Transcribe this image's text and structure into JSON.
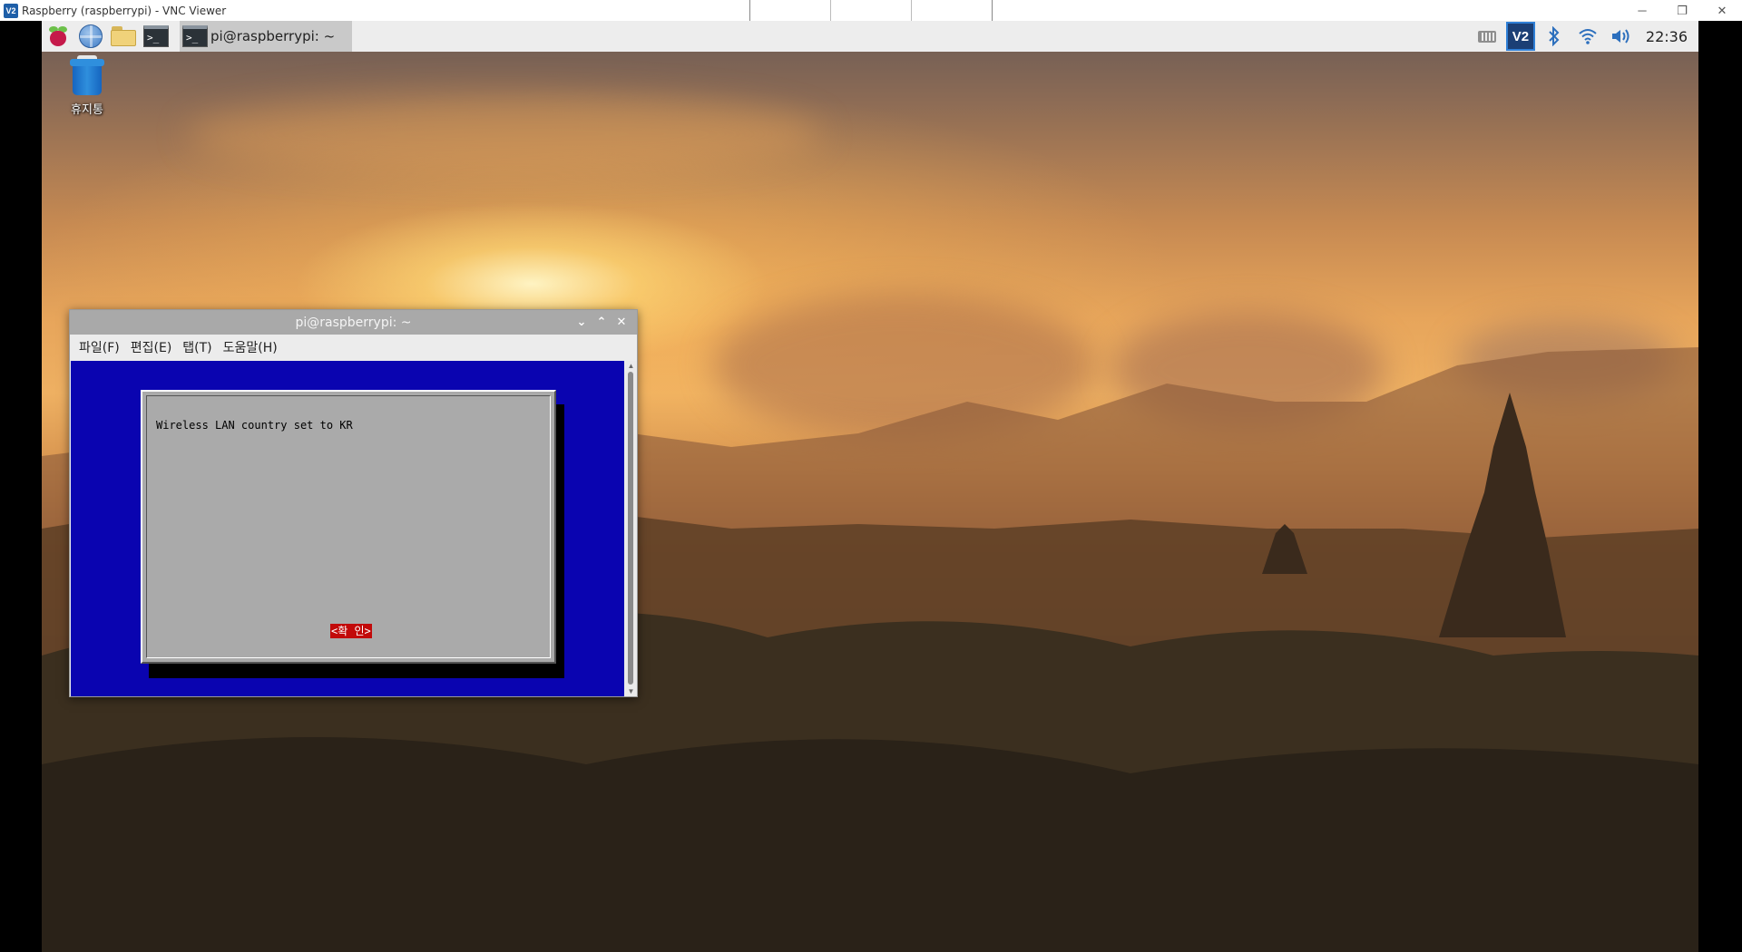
{
  "vnc": {
    "icon_text": "V2",
    "title": "Raspberry (raspberrypi) - VNC Viewer",
    "controls": [
      "─",
      "❐",
      "✕"
    ]
  },
  "panel": {
    "task_title": "pi@raspberrypi: ~",
    "tray": {
      "vnc_text": "V2",
      "bluetooth": "bluetooth-icon",
      "wifi": "wifi-icon",
      "volume": "volume-icon",
      "clock": "22:36"
    }
  },
  "desktop": {
    "trash_label": "휴지통"
  },
  "terminal": {
    "title": "pi@raspberrypi: ~",
    "controls": [
      "⌄",
      "⌃",
      "✕"
    ],
    "menu": [
      "파일(F)",
      "편집(E)",
      "탭(T)",
      "도움말(H)"
    ],
    "dialog": {
      "message": "Wireless LAN country set to KR",
      "ok_button": "<확 인>"
    }
  },
  "colors": {
    "terminal_bg": "#0a04b0",
    "dialog_bg": "#aaaaaa",
    "button_bg": "#c20a0a",
    "panel_bg": "#ededed"
  }
}
